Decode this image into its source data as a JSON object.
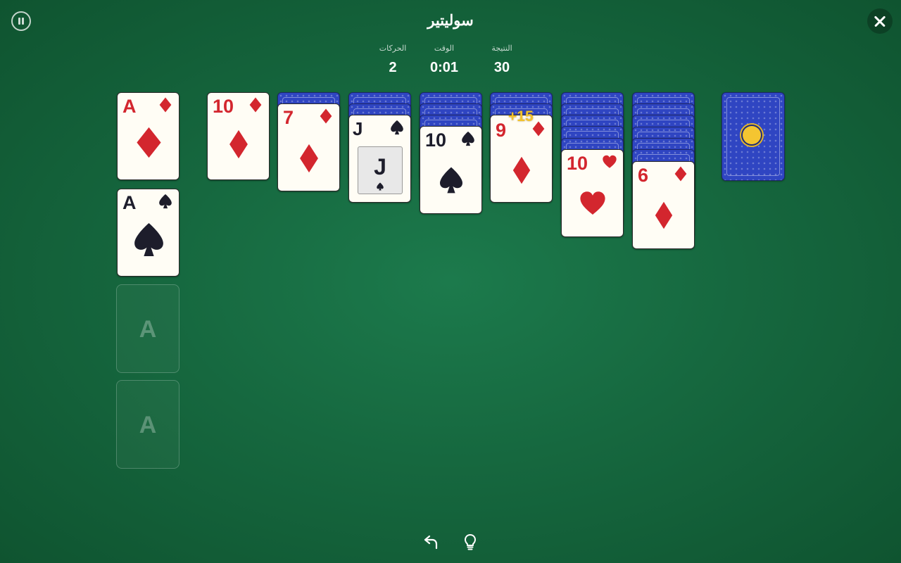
{
  "header": {
    "title": "سوليتير",
    "stats": [
      {
        "label": "الحركات",
        "value": "2"
      },
      {
        "label": "الوقت",
        "value": "0:01"
      },
      {
        "label": "النتيجة",
        "value": "30"
      }
    ]
  },
  "foundations": {
    "diamonds": {
      "rank": "A",
      "suit": "diamonds"
    },
    "spades": {
      "rank": "A",
      "suit": "spades"
    },
    "empty_labels": [
      "A",
      "A"
    ]
  },
  "tableau": [
    {
      "face_down": 0,
      "top": {
        "rank": "10",
        "suit": "diamonds"
      }
    },
    {
      "face_down": 1,
      "top": {
        "rank": "7",
        "suit": "diamonds"
      }
    },
    {
      "face_down": 2,
      "top": {
        "rank": "J",
        "suit": "spades"
      }
    },
    {
      "face_down": 3,
      "top": {
        "rank": "10",
        "suit": "spades"
      }
    },
    {
      "face_down": 2,
      "top": {
        "rank": "9",
        "suit": "diamonds"
      }
    },
    {
      "face_down": 5,
      "top": {
        "rank": "10",
        "suit": "hearts"
      }
    },
    {
      "face_down": 6,
      "top": {
        "rank": "6",
        "suit": "diamonds"
      }
    }
  ],
  "bonus_popup": "+15",
  "stock": {
    "icon": "coin-medal-icon"
  },
  "icons": {
    "pause": "pause-icon",
    "close": "close-icon",
    "undo": "undo-icon",
    "hint": "lightbulb-icon"
  },
  "colors": {
    "felt": "#1c7a4c",
    "red_suit": "#d3262e",
    "black_suit": "#1d1d2b",
    "card_back": "#2f45c2",
    "bonus": "#f2c22c"
  }
}
